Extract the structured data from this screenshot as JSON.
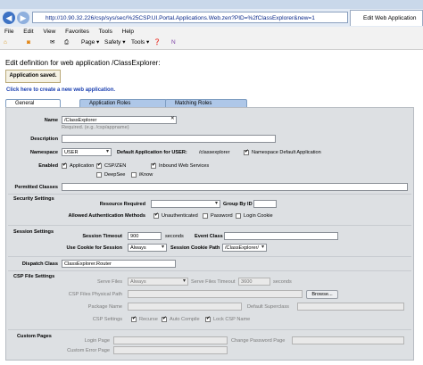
{
  "browser": {
    "url": "http://10.90.32.226/csp/sys/sec/%25CSP.UI.Portal.Applications.Web.zen?PID=%2fClassExplorer&new=1",
    "tab_title": "Edit Web Application",
    "menu": [
      "File",
      "Edit",
      "View",
      "Favorites",
      "Tools",
      "Help"
    ],
    "toolbar": {
      "page": "Page ▾",
      "safety": "Safety ▾",
      "tools": "Tools ▾"
    }
  },
  "page": {
    "heading": "Edit definition for web application /ClassExplorer:",
    "saved_message": "Application saved.",
    "create_link": "Click here to create a new web application.",
    "tabs": [
      "General",
      "Application Roles",
      "Matching Roles"
    ]
  },
  "form": {
    "name_label": "Name",
    "name_value": "/ClassExplorer",
    "name_hint": "Required. (e.g. /csp/appname)",
    "description_label": "Description",
    "namespace_label": "Namespace",
    "namespace_value": "USER",
    "default_app_label": "Default Application for USER:",
    "default_app_value": "/classexplorer",
    "namespace_default_label": "Namespace Default Application",
    "enabled_label": "Enabled",
    "application_label": "Application",
    "cspzen_label": "CSP/ZEN",
    "inbound_label": "Inbound Web Services",
    "deepsee_label": "DeepSee",
    "iknow_label": "iKnow",
    "permitted_label": "Permitted Classes",
    "security_label": "Security Settings",
    "resource_label": "Resource Required",
    "group_label": "Group By ID",
    "auth_label": "Allowed Authentication Methods",
    "unauth_label": "Unauthenticated",
    "password_label": "Password",
    "login_cookie_label": "Login Cookie",
    "session_label": "Session Settings",
    "timeout_label": "Session Timeout",
    "timeout_value": "900",
    "seconds": "seconds",
    "event_label": "Event Class",
    "cookie_label": "Use Cookie for Session",
    "cookie_value": "Always",
    "cookie_path_label": "Session Cookie Path",
    "cookie_path_value": "/ClassExplorer/",
    "dispatch_label": "Dispatch Class",
    "dispatch_value": "ClassExplorer.Router",
    "csp_label": "CSP File Settings",
    "serve_label": "Serve Files",
    "serve_value": "Always",
    "serve_timeout_label": "Serve Files Timeout",
    "serve_timeout_value": "3600",
    "physical_label": "CSP Files Physical Path",
    "browse": "Browse...",
    "package_label": "Package Name",
    "superclass_label": "Default Superclass",
    "csp_settings_label": "CSP Settings",
    "recurse_label": "Recurse",
    "autocompile_label": "Auto Compile",
    "lock_label": "Lock CSP Name",
    "custom_label": "Custom Pages",
    "login_page_label": "Login Page",
    "change_pw_label": "Change Password Page",
    "custom_error_label": "Custom Error Page"
  }
}
